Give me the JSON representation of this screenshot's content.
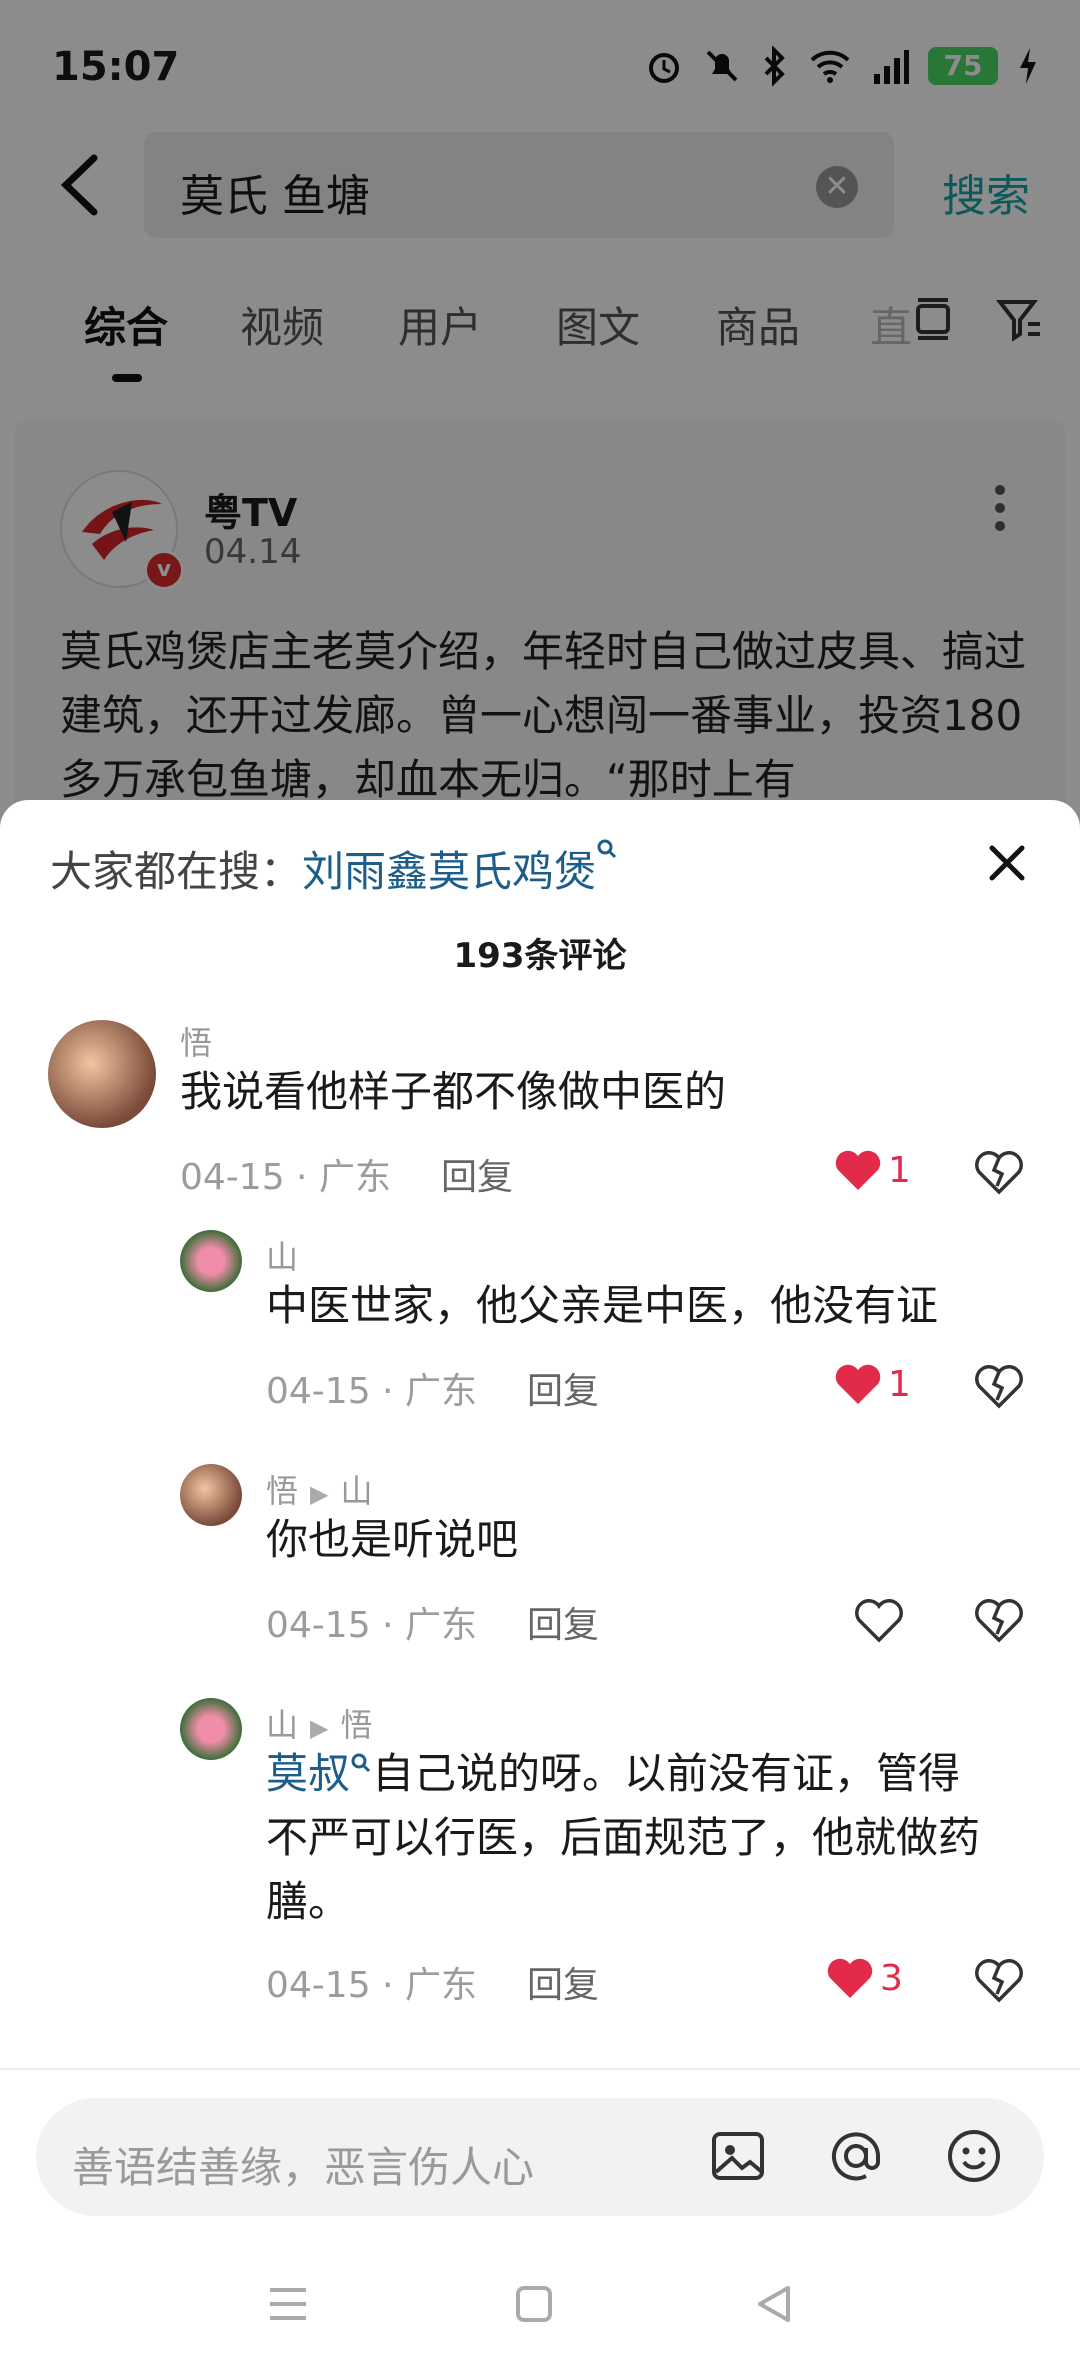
{
  "status": {
    "time": "15:07",
    "battery": "75"
  },
  "search": {
    "query": "莫氏 鱼塘",
    "search_label": "搜索"
  },
  "tabs": [
    "综合",
    "视频",
    "用户",
    "图文",
    "商品",
    "直"
  ],
  "card": {
    "name": "粤TV",
    "date": "04.14",
    "text": "莫氏鸡煲店主老莫介绍，年轻时自己做过皮具、搞过建筑，还开过发廊。曾一心想闯一番事业，投资180多万承包鱼塘，却血本无归。“那时上有"
  },
  "sheet": {
    "trending_prefix": "大家都在搜：",
    "trending_link": "刘雨鑫莫氏鸡煲",
    "count_title": "193条评论",
    "comments": [
      {
        "name": "悟",
        "text": "我说看他样子都不像做中医的",
        "meta": "04-15 · 广东",
        "reply": "回复",
        "likes": "1"
      },
      {
        "name": "山",
        "text": "中医世家，他父亲是中医，他没有证",
        "meta": "04-15 · 广东",
        "reply": "回复",
        "likes": "1"
      },
      {
        "name": "悟",
        "reply_to": "山",
        "text": "你也是听说吧",
        "meta": "04-15 · 广东",
        "reply": "回复",
        "likes": ""
      },
      {
        "name": "山",
        "reply_to": "悟",
        "mention": "莫叔",
        "text_line1": "自己说的呀。以前没有证，管得",
        "text_line2": "不严可以行医，后面规范了，他就做药",
        "text_line3": "膳。",
        "meta": "04-15 · 广东",
        "reply": "回复",
        "likes": "3"
      }
    ],
    "input_placeholder": "善语结善缘，恶言伤人心"
  },
  "colors": {
    "accent_teal": "#17a3a8",
    "link_blue": "#1d5d8a",
    "like_red": "#e22b4a"
  }
}
